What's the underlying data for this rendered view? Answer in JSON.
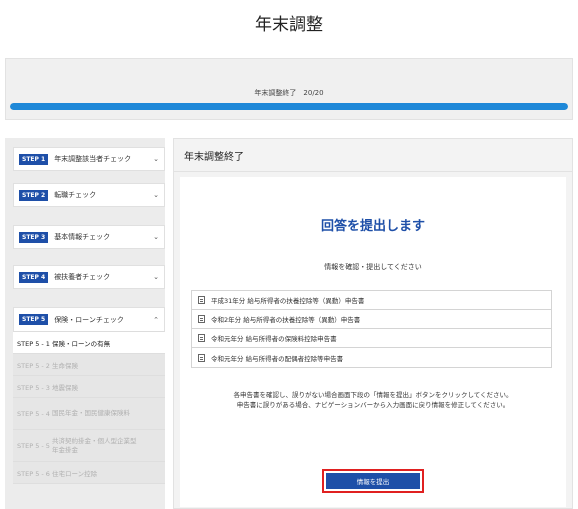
{
  "page_title": "年末調整",
  "progress": {
    "text": "年末調整終了　20/20",
    "current": 20,
    "total": 20
  },
  "sidebar": {
    "steps": [
      {
        "badge": "STEP 1",
        "label": "年末調整該当者チェック",
        "chevron": "⌄",
        "icon": "chevron-down-icon"
      },
      {
        "badge": "STEP 2",
        "label": "転職チェック",
        "chevron": "⌄",
        "icon": "chevron-down-icon"
      },
      {
        "badge": "STEP 3",
        "label": "基本情報チェック",
        "chevron": "⌄",
        "icon": "chevron-down-icon"
      },
      {
        "badge": "STEP 4",
        "label": "被扶養者チェック",
        "chevron": "⌄",
        "icon": "chevron-down-icon"
      },
      {
        "badge": "STEP 5",
        "label": "保険・ローンチェック",
        "chevron": "⌃",
        "icon": "chevron-up-icon"
      }
    ],
    "sub_items": [
      {
        "label": "STEP 5 - 1  保険・ローンの有無"
      },
      {
        "label": "STEP 5 - 2  生命保険"
      },
      {
        "label": "STEP 5 - 3  地震保険"
      },
      {
        "label": "STEP 5 - 4",
        "extra": "国民年金・国民健康保険料"
      },
      {
        "label": "STEP 5 - 5",
        "extra": "共済契約掛金・個人型企業型年金掛金"
      },
      {
        "label": "STEP 5 - 6  住宅ローン控除"
      }
    ]
  },
  "main": {
    "header": "年末調整終了",
    "submit_title": "回答を提出します",
    "confirm_text": "情報を確認・提出してください",
    "documents": [
      "平成31年分 給与所得者の扶養控除等（異動）申告書",
      "令和2年分 給与所得者の扶養控除等（異動）申告書",
      "令和元年分 給与所得者の保険料控除申告書",
      "令和元年分 給与所得者の配偶者控除等申告書"
    ],
    "instructions_line1": "各申告書を確認し、誤りがない場合画面下段の「情報を提出」ボタンをクリックしてください。",
    "instructions_line2": "申告書に誤りがある場合、ナビゲーションバーから入力画面に戻り情報を修正してください。",
    "submit_button": "情報を提出"
  },
  "colors": {
    "accent": "#1e4fa8",
    "progress": "#1e88d8",
    "highlight": "#e02020"
  }
}
